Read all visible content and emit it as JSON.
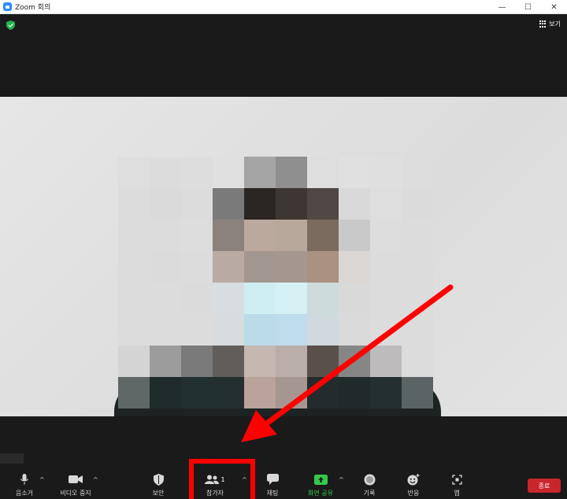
{
  "window": {
    "title": "Zoom 회의",
    "minimize": "—",
    "maximize": "☐",
    "close": "✕"
  },
  "top": {
    "view_label": "보기"
  },
  "toolbar": {
    "mute_label": "음소거",
    "video_label": "비디오 중지",
    "security_label": "보안",
    "participants_label": "참가자",
    "participants_count": "1",
    "chat_label": "채팅",
    "share_label": "화면 공유",
    "record_label": "기록",
    "reactions_label": "반응",
    "apps_label": "앱",
    "caret": "^",
    "end_label": "종료"
  },
  "colors": {
    "share_green": "#35c94b",
    "end_red": "#c8262b",
    "annotation_red": "#ff0000"
  }
}
